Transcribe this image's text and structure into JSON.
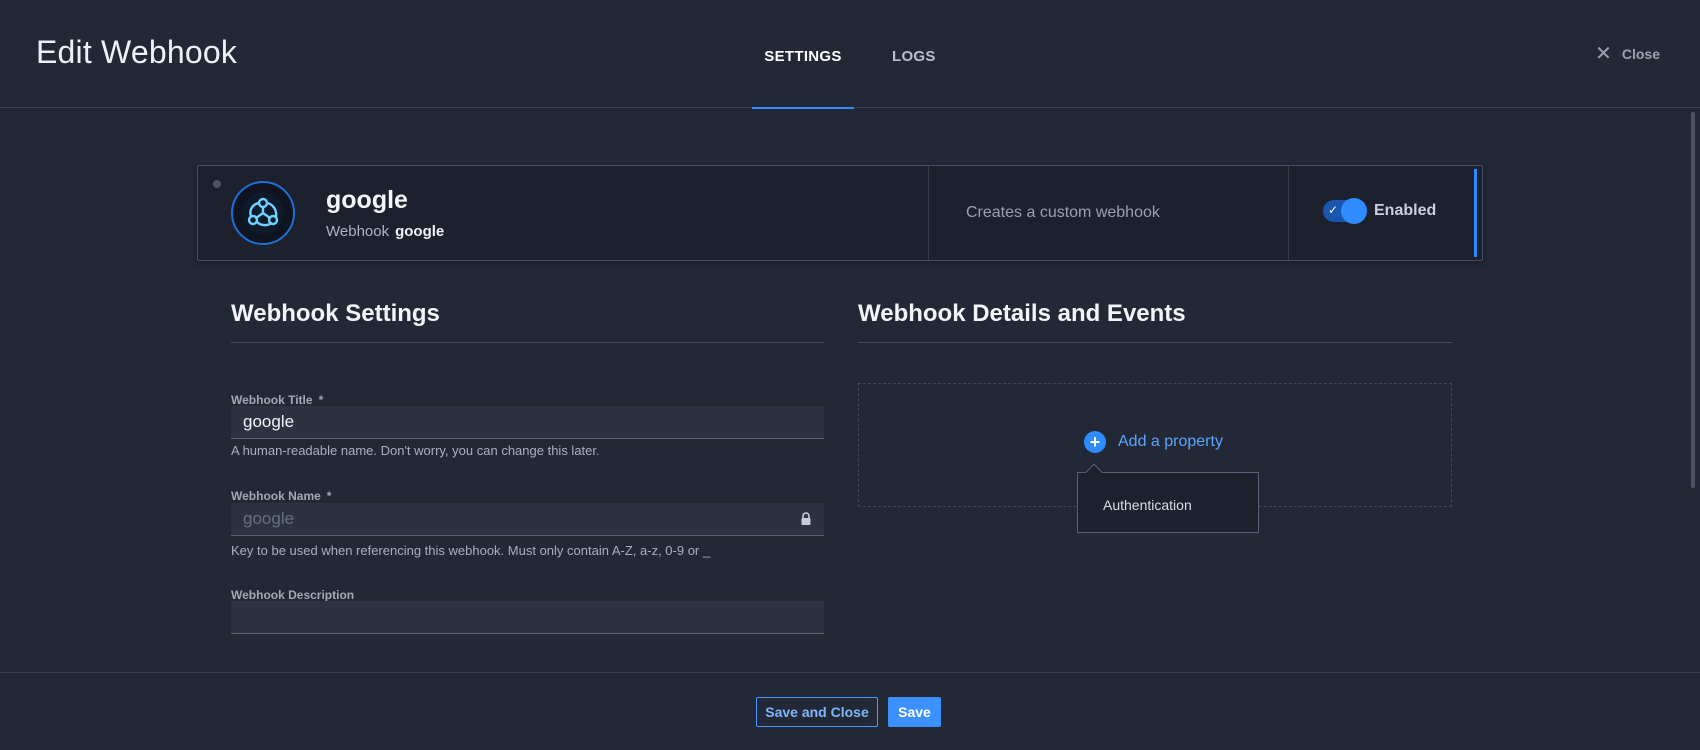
{
  "header": {
    "title": "Edit Webhook",
    "tabs": [
      {
        "label": "SETTINGS",
        "active": true
      },
      {
        "label": "LOGS",
        "active": false
      }
    ],
    "close_label": "Close"
  },
  "webhook_card": {
    "name": "google",
    "subtitle_prefix": "Webhook",
    "subtitle_name": "google",
    "description": "Creates a custom webhook",
    "toggle_label": "Enabled",
    "enabled": true,
    "accent_color": "#2f8cff"
  },
  "settings": {
    "section_title": "Webhook Settings",
    "fields": {
      "title": {
        "label": "Webhook Title",
        "required_mark": "*",
        "value": "google",
        "hint": "A human-readable name. Don't worry, you can change this later."
      },
      "name": {
        "label": "Webhook Name",
        "required_mark": "*",
        "value": "google",
        "locked": true,
        "hint": "Key to be used when referencing this webhook. Must only contain A-Z, a-z, 0-9 or _"
      },
      "description": {
        "label": "Webhook Description",
        "value": ""
      }
    }
  },
  "details": {
    "section_title": "Webhook Details and Events",
    "add_property_label": "Add a property",
    "menu_items": [
      "Authentication"
    ]
  },
  "footer": {
    "save_close_label": "Save and Close",
    "save_label": "Save"
  }
}
